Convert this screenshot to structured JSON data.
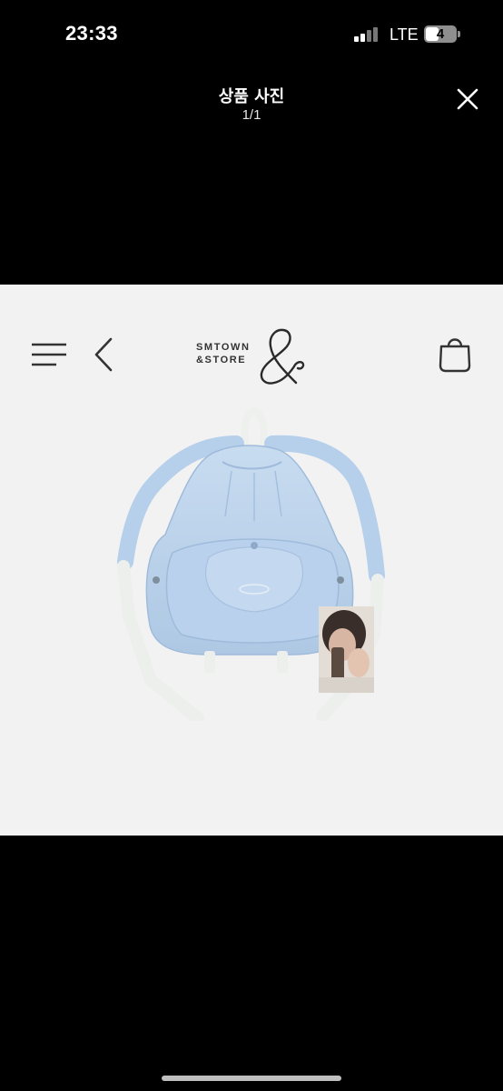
{
  "status": {
    "time": "23:33",
    "network": "LTE",
    "battery": "4"
  },
  "header": {
    "title": "상품 사진",
    "counter": "1/1"
  },
  "photo": {
    "brand_line1": "SMTOWN",
    "brand_line2": "&STORE",
    "icons": [
      "menu-icon",
      "back-icon",
      "shopping-bag-icon",
      "close-icon"
    ]
  },
  "colors": {
    "background": "#000000",
    "photo_background": "#f2f2f2",
    "backpack_blue": "#bcd3ec"
  }
}
